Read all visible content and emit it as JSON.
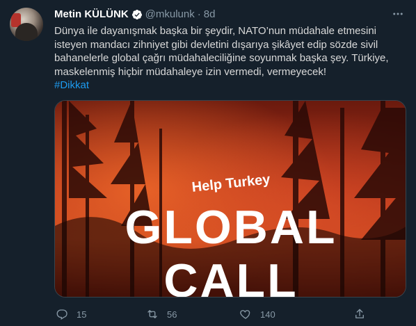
{
  "author": {
    "name": "Metin KÜLÜNK",
    "handle": "@mkulunk",
    "separator": "·",
    "time": "8d"
  },
  "tweet": {
    "text": "Dünya ile dayanışmak başka bir şeydir, NATO’nun müdahale etmesini isteyen mandacı zihniyet gibi devletini dışarıya şikâyet edip sözde sivil bahanelerle global çağrı müdahaleciliğine soyunmak başka şey. Türkiye, maskelenmiş hiçbir müdahaleye izin vermedi, vermeyecek!",
    "hashtag": "#Dikkat"
  },
  "media": {
    "subtitle": "Help Turkey",
    "headline_1": "GLOBAL",
    "headline_2": "CALL"
  },
  "actions": {
    "reply_count": "15",
    "retweet_count": "56",
    "like_count": "140"
  },
  "icons": {
    "more": "more-icon",
    "verified": "verified-badge-icon",
    "reply": "reply-icon",
    "retweet": "retweet-icon",
    "like": "heart-icon",
    "share": "share-icon"
  },
  "colors": {
    "background": "#15202b",
    "link": "#1d9bf0",
    "muted": "#8899a6",
    "text": "#d9d9d9"
  }
}
